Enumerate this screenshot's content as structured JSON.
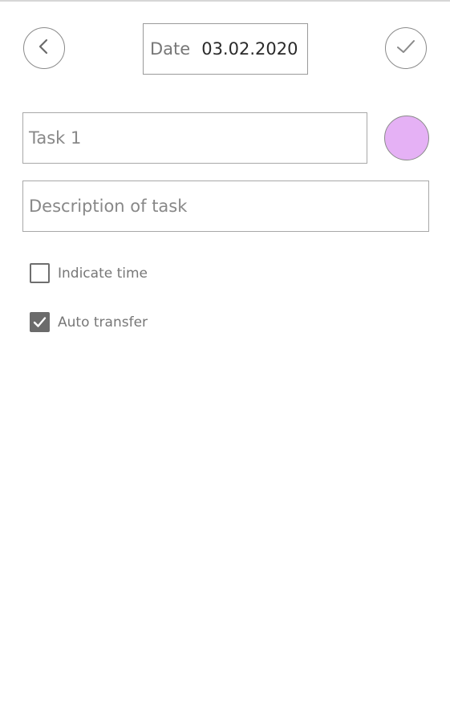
{
  "header": {
    "back_icon": "chevron-left-icon",
    "date_label": "Date",
    "date_value": "03.02.2020",
    "confirm_icon": "checkmark-icon"
  },
  "task": {
    "title_value": "Task 1",
    "description_placeholder": "Description of task",
    "color": "#e5b1f5"
  },
  "options": [
    {
      "label": "Indicate time",
      "checked": false
    },
    {
      "label": "Auto transfer",
      "checked": true
    }
  ]
}
